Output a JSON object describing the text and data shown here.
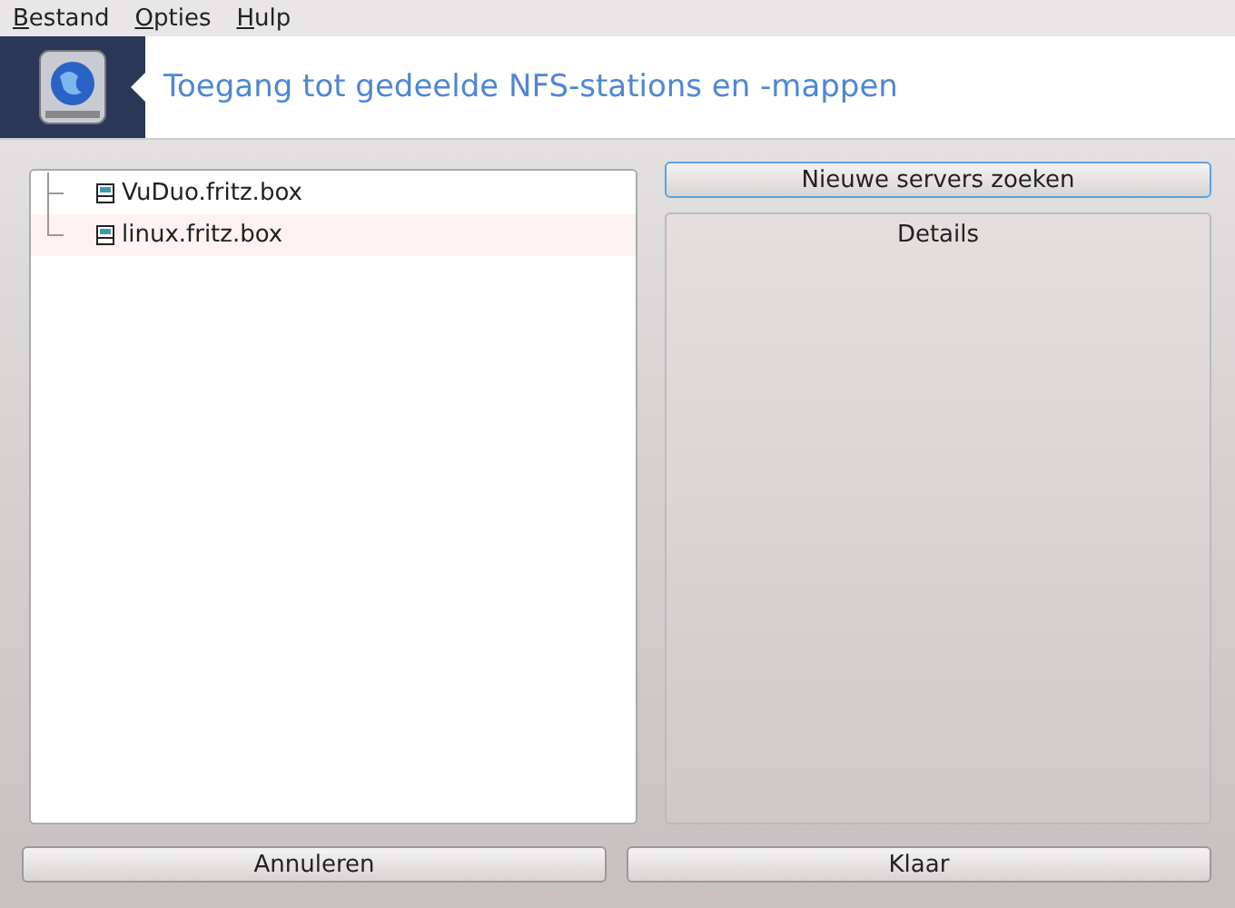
{
  "menu": [
    {
      "label": "Bestand"
    },
    {
      "label": "Opties"
    },
    {
      "label": "Hulp"
    }
  ],
  "header": {
    "title": "Toegang tot gedeelde NFS-stations en -mappen"
  },
  "servers": [
    {
      "label": "VuDuo.fritz.box"
    },
    {
      "label": "linux.fritz.box"
    }
  ],
  "search_button": "Nieuwe servers zoeken",
  "details": {
    "title": "Details"
  },
  "buttons": [
    "Annuleren",
    "Klaar"
  ]
}
